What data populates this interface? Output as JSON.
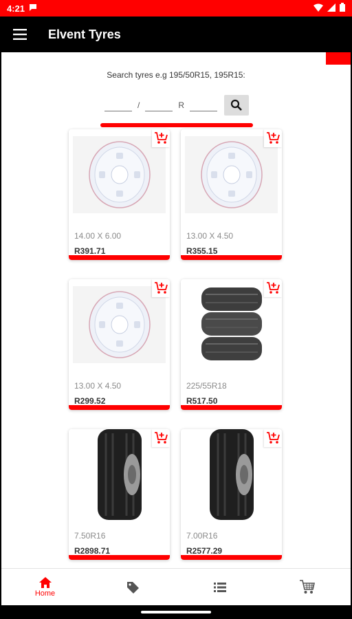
{
  "status_bar": {
    "time": "4:21"
  },
  "app_bar": {
    "title": "Elvent Tyres"
  },
  "search": {
    "caption": "Search tyres e.g 195/50R15, 195R15:",
    "separator_slash": "/",
    "separator_r": "R"
  },
  "products": [
    {
      "size": "14.00 X 6.00",
      "price": "R391.71",
      "image": "steel-wheel"
    },
    {
      "size": "13.00 X 4.50",
      "price": "R355.15",
      "image": "steel-wheel"
    },
    {
      "size": "13.00 X 4.50",
      "price": "R299.52",
      "image": "steel-wheel"
    },
    {
      "size": "225/55R18",
      "price": "R517.50",
      "image": "tyre-stack"
    },
    {
      "size": "7.50R16",
      "price": "R2898.71",
      "image": "truck-tyre"
    },
    {
      "size": "7.00R16",
      "price": "R2577.29",
      "image": "truck-tyre"
    }
  ],
  "bottom_nav": {
    "items": [
      {
        "label": "Home",
        "icon": "home-icon",
        "active": true
      },
      {
        "label": "",
        "icon": "tag-icon"
      },
      {
        "label": "",
        "icon": "list-icon"
      },
      {
        "label": "",
        "icon": "cart-icon"
      }
    ]
  },
  "colors": {
    "accent": "#ff0000",
    "app_bar": "#000000"
  }
}
